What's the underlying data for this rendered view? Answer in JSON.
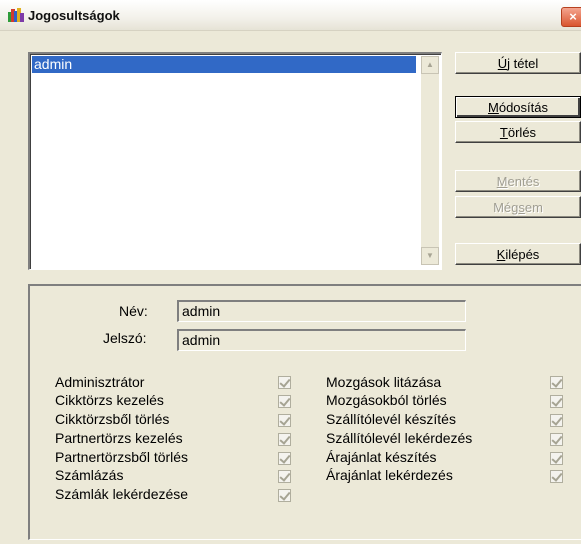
{
  "window": {
    "title": "Jogosultságok",
    "close_glyph": "×"
  },
  "list": {
    "items": [
      "admin"
    ]
  },
  "buttons": {
    "new": {
      "accel": "Ú",
      "rest": "j tétel"
    },
    "modify": {
      "accel": "M",
      "rest": "ódosítás"
    },
    "delete": {
      "accel": "T",
      "rest": "örlés"
    },
    "save": {
      "accel": "M",
      "rest": "entés"
    },
    "cancel": {
      "pre": "Még",
      "accel": "s",
      "rest": "em"
    },
    "exit": {
      "accel": "K",
      "rest": "ilépés"
    }
  },
  "form": {
    "name_label": "Név:",
    "name_value": "admin",
    "password_label": "Jelszó:",
    "password_value": "admin"
  },
  "permissions_left": [
    "Adminisztrátor",
    "Cikktörzs kezelés",
    "Cikktörzsből törlés",
    "Partnertörzs kezelés",
    "Partnertörzsből törlés",
    "Számlázás",
    "Számlák lekérdezése"
  ],
  "permissions_right": [
    "Mozgások litázása",
    "Mozgásokból törlés",
    "Szállítólevél készítés",
    "Szállítólevél lekérdezés",
    "Árajánlat készítés",
    "Árajánlat lekérdezés"
  ]
}
